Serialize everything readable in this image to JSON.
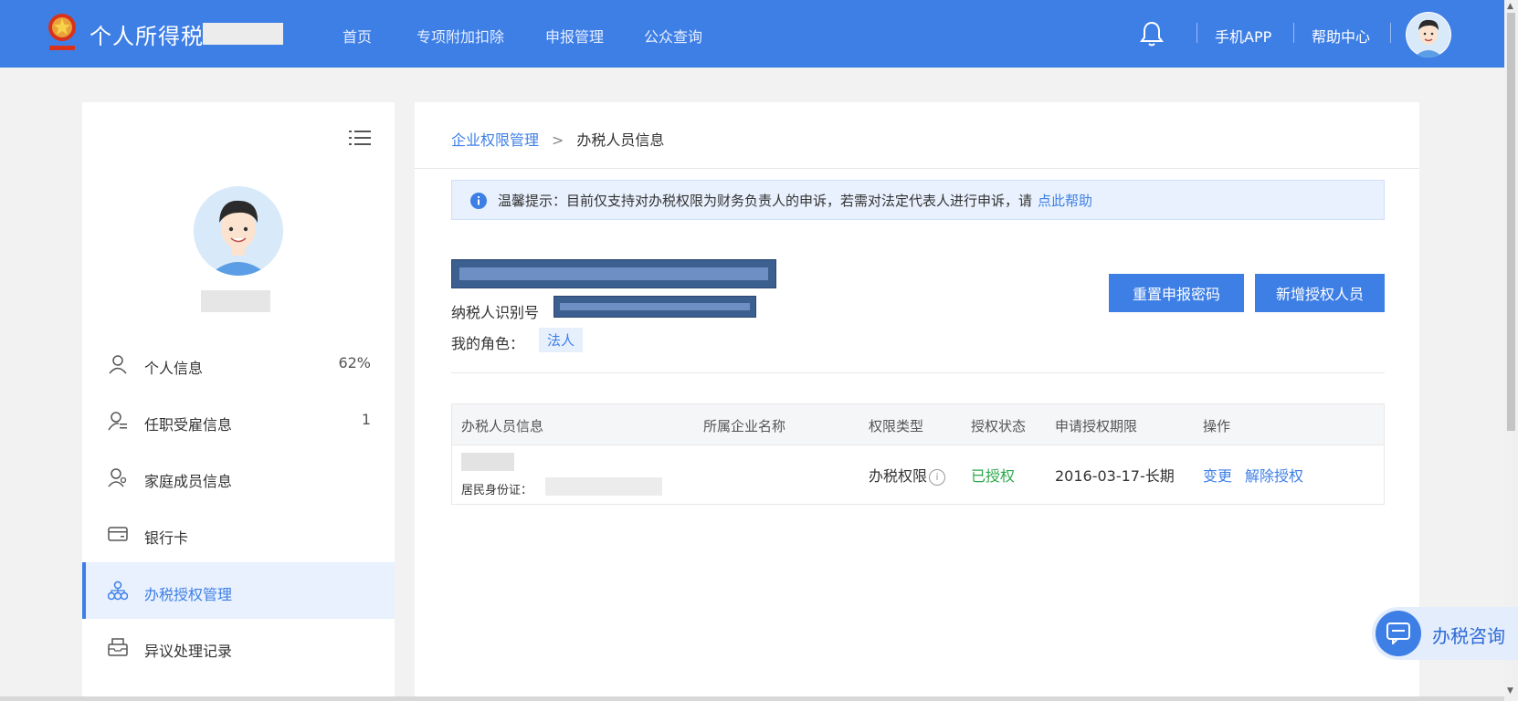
{
  "header": {
    "brand_title": "个人所得税",
    "nav": [
      "首页",
      "专项附加扣除",
      "申报管理",
      "公众查询"
    ],
    "links": {
      "mobile_app": "手机APP",
      "help_center": "帮助中心"
    }
  },
  "sidebar": {
    "items": [
      {
        "label": "个人信息",
        "count": "62%",
        "icon": "person-icon"
      },
      {
        "label": "任职受雇信息",
        "count": "1",
        "icon": "person-list-icon"
      },
      {
        "label": "家庭成员信息",
        "count": "",
        "icon": "family-icon"
      },
      {
        "label": "银行卡",
        "count": "",
        "icon": "bank-card-icon"
      },
      {
        "label": "办税授权管理",
        "count": "",
        "icon": "org-tree-icon",
        "active": true
      },
      {
        "label": "异议处理记录",
        "count": "",
        "icon": "inbox-icon"
      }
    ]
  },
  "main": {
    "breadcrumb": {
      "parent": "企业权限管理",
      "separator": ">",
      "current": "办税人员信息"
    },
    "tip": {
      "text": "温馨提示：目前仅支持对办税权限为财务负责人的申诉，若需对法定代表人进行申诉，请",
      "link": "点此帮助"
    },
    "company": {
      "taxid_label": "纳税人识别号",
      "role_label": "我的角色：",
      "role_value": "法人"
    },
    "buttons": {
      "reset_password": "重置申报密码",
      "add_authorized": "新增授权人员"
    },
    "table": {
      "headers": [
        "办税人员信息",
        "所属企业名称",
        "权限类型",
        "授权状态",
        "申请授权期限",
        "操作"
      ],
      "row": {
        "id_label": "居民身份证：",
        "permission_type": "办税权限",
        "status": "已授权",
        "period": "2016-03-17-长期",
        "actions": [
          "变更",
          "解除授权"
        ]
      }
    }
  },
  "chat": {
    "label": "办税咨询"
  },
  "colors": {
    "brand": "#3e7fe6",
    "success": "#2aa84a",
    "background": "#f2f2f2"
  }
}
